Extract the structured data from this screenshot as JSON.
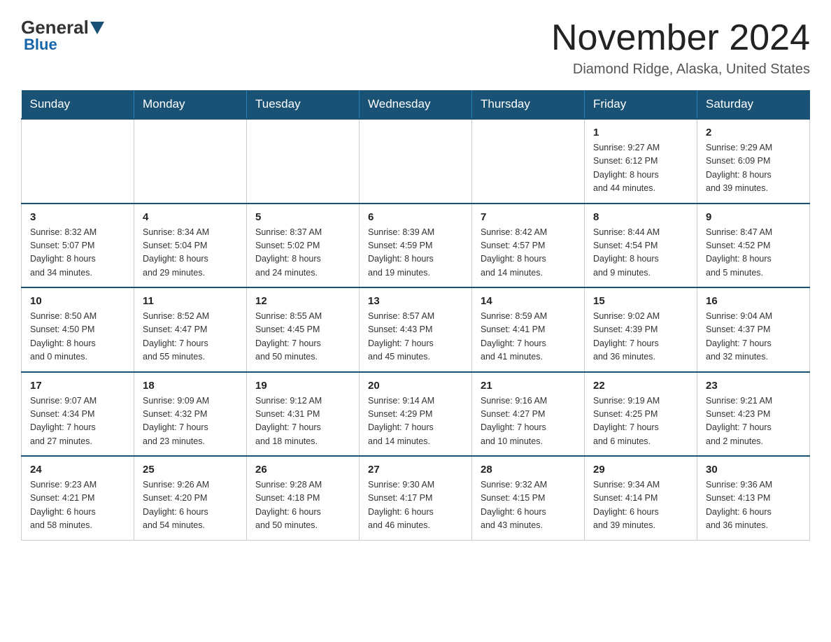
{
  "logo": {
    "general": "General",
    "blue": "Blue",
    "sub": "Blue"
  },
  "header": {
    "title": "November 2024",
    "subtitle": "Diamond Ridge, Alaska, United States"
  },
  "days_of_week": [
    "Sunday",
    "Monday",
    "Tuesday",
    "Wednesday",
    "Thursday",
    "Friday",
    "Saturday"
  ],
  "weeks": [
    [
      {
        "day": "",
        "info": ""
      },
      {
        "day": "",
        "info": ""
      },
      {
        "day": "",
        "info": ""
      },
      {
        "day": "",
        "info": ""
      },
      {
        "day": "",
        "info": ""
      },
      {
        "day": "1",
        "info": "Sunrise: 9:27 AM\nSunset: 6:12 PM\nDaylight: 8 hours\nand 44 minutes."
      },
      {
        "day": "2",
        "info": "Sunrise: 9:29 AM\nSunset: 6:09 PM\nDaylight: 8 hours\nand 39 minutes."
      }
    ],
    [
      {
        "day": "3",
        "info": "Sunrise: 8:32 AM\nSunset: 5:07 PM\nDaylight: 8 hours\nand 34 minutes."
      },
      {
        "day": "4",
        "info": "Sunrise: 8:34 AM\nSunset: 5:04 PM\nDaylight: 8 hours\nand 29 minutes."
      },
      {
        "day": "5",
        "info": "Sunrise: 8:37 AM\nSunset: 5:02 PM\nDaylight: 8 hours\nand 24 minutes."
      },
      {
        "day": "6",
        "info": "Sunrise: 8:39 AM\nSunset: 4:59 PM\nDaylight: 8 hours\nand 19 minutes."
      },
      {
        "day": "7",
        "info": "Sunrise: 8:42 AM\nSunset: 4:57 PM\nDaylight: 8 hours\nand 14 minutes."
      },
      {
        "day": "8",
        "info": "Sunrise: 8:44 AM\nSunset: 4:54 PM\nDaylight: 8 hours\nand 9 minutes."
      },
      {
        "day": "9",
        "info": "Sunrise: 8:47 AM\nSunset: 4:52 PM\nDaylight: 8 hours\nand 5 minutes."
      }
    ],
    [
      {
        "day": "10",
        "info": "Sunrise: 8:50 AM\nSunset: 4:50 PM\nDaylight: 8 hours\nand 0 minutes."
      },
      {
        "day": "11",
        "info": "Sunrise: 8:52 AM\nSunset: 4:47 PM\nDaylight: 7 hours\nand 55 minutes."
      },
      {
        "day": "12",
        "info": "Sunrise: 8:55 AM\nSunset: 4:45 PM\nDaylight: 7 hours\nand 50 minutes."
      },
      {
        "day": "13",
        "info": "Sunrise: 8:57 AM\nSunset: 4:43 PM\nDaylight: 7 hours\nand 45 minutes."
      },
      {
        "day": "14",
        "info": "Sunrise: 8:59 AM\nSunset: 4:41 PM\nDaylight: 7 hours\nand 41 minutes."
      },
      {
        "day": "15",
        "info": "Sunrise: 9:02 AM\nSunset: 4:39 PM\nDaylight: 7 hours\nand 36 minutes."
      },
      {
        "day": "16",
        "info": "Sunrise: 9:04 AM\nSunset: 4:37 PM\nDaylight: 7 hours\nand 32 minutes."
      }
    ],
    [
      {
        "day": "17",
        "info": "Sunrise: 9:07 AM\nSunset: 4:34 PM\nDaylight: 7 hours\nand 27 minutes."
      },
      {
        "day": "18",
        "info": "Sunrise: 9:09 AM\nSunset: 4:32 PM\nDaylight: 7 hours\nand 23 minutes."
      },
      {
        "day": "19",
        "info": "Sunrise: 9:12 AM\nSunset: 4:31 PM\nDaylight: 7 hours\nand 18 minutes."
      },
      {
        "day": "20",
        "info": "Sunrise: 9:14 AM\nSunset: 4:29 PM\nDaylight: 7 hours\nand 14 minutes."
      },
      {
        "day": "21",
        "info": "Sunrise: 9:16 AM\nSunset: 4:27 PM\nDaylight: 7 hours\nand 10 minutes."
      },
      {
        "day": "22",
        "info": "Sunrise: 9:19 AM\nSunset: 4:25 PM\nDaylight: 7 hours\nand 6 minutes."
      },
      {
        "day": "23",
        "info": "Sunrise: 9:21 AM\nSunset: 4:23 PM\nDaylight: 7 hours\nand 2 minutes."
      }
    ],
    [
      {
        "day": "24",
        "info": "Sunrise: 9:23 AM\nSunset: 4:21 PM\nDaylight: 6 hours\nand 58 minutes."
      },
      {
        "day": "25",
        "info": "Sunrise: 9:26 AM\nSunset: 4:20 PM\nDaylight: 6 hours\nand 54 minutes."
      },
      {
        "day": "26",
        "info": "Sunrise: 9:28 AM\nSunset: 4:18 PM\nDaylight: 6 hours\nand 50 minutes."
      },
      {
        "day": "27",
        "info": "Sunrise: 9:30 AM\nSunset: 4:17 PM\nDaylight: 6 hours\nand 46 minutes."
      },
      {
        "day": "28",
        "info": "Sunrise: 9:32 AM\nSunset: 4:15 PM\nDaylight: 6 hours\nand 43 minutes."
      },
      {
        "day": "29",
        "info": "Sunrise: 9:34 AM\nSunset: 4:14 PM\nDaylight: 6 hours\nand 39 minutes."
      },
      {
        "day": "30",
        "info": "Sunrise: 9:36 AM\nSunset: 4:13 PM\nDaylight: 6 hours\nand 36 minutes."
      }
    ]
  ]
}
